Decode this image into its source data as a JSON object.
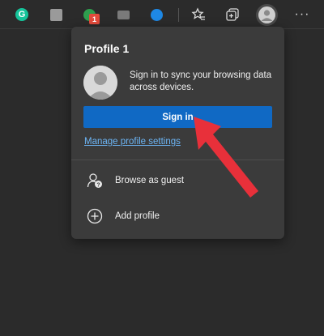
{
  "toolbar": {
    "extensions": [
      {
        "name": "grammarly-icon",
        "glyph": "G"
      },
      {
        "name": "extension-icon-2"
      },
      {
        "name": "extension-icon-3",
        "badge": "1"
      },
      {
        "name": "extension-icon-4"
      },
      {
        "name": "extension-icon-5"
      }
    ],
    "favorites_icon": "favorites-star-icon",
    "collections_icon": "collections-icon",
    "profile_icon": "profile-avatar-icon",
    "more_icon": "more-icon",
    "more_glyph": "···"
  },
  "profile_panel": {
    "profile_name": "Profile 1",
    "sync_text": "Sign in to sync your browsing data across devices.",
    "sign_in_label": "Sign in",
    "manage_link": "Manage profile settings",
    "menu": [
      {
        "label": "Browse as guest",
        "icon": "guest-icon"
      },
      {
        "label": "Add profile",
        "icon": "add-icon"
      }
    ]
  },
  "colors": {
    "background": "#2b2b2b",
    "panel": "#3b3b3b",
    "accent": "#1069c4",
    "link": "#6cb5f5",
    "arrow": "#e8303a"
  }
}
